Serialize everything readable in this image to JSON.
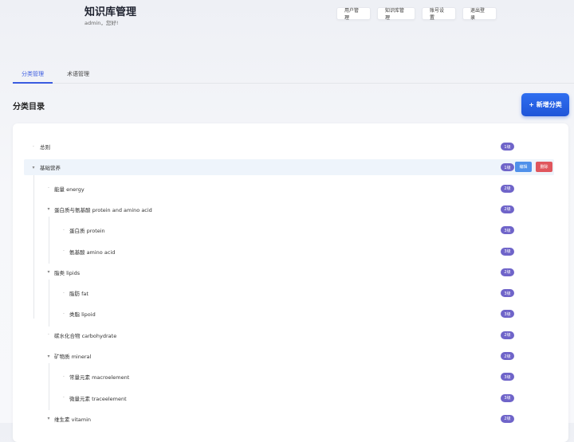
{
  "header": {
    "title": "知识库管理",
    "greeting": "admin，您好!"
  },
  "nav": {
    "user_management": "用户管理",
    "kb_management": "知识库管理",
    "account_settings": "账号设置",
    "logout": "退出登录"
  },
  "tabs": {
    "category": "分类管理",
    "term": "术语管理",
    "active": "category"
  },
  "section": {
    "title": "分类目录",
    "add_button": "+ 新增分类"
  },
  "row_actions": {
    "edit": "编辑",
    "delete": "删除"
  },
  "tree": [
    {
      "label": "总则",
      "level": "1级",
      "toggle": "·",
      "depth": 0
    },
    {
      "label": "基础营养",
      "level": "1级",
      "toggle": "▾",
      "depth": 0,
      "selected": true
    },
    {
      "label": "能量 energy",
      "level": "2级",
      "toggle": "·",
      "depth": 1
    },
    {
      "label": "蛋白质与氨基酸 protein and amino acid",
      "level": "2级",
      "toggle": "▾",
      "depth": 1
    },
    {
      "label": "蛋白质 protein",
      "level": "3级",
      "toggle": "·",
      "depth": 2
    },
    {
      "label": "氨基酸 amino acid",
      "level": "3级",
      "toggle": "·",
      "depth": 2
    },
    {
      "label": "脂类 lipids",
      "level": "2级",
      "toggle": "▾",
      "depth": 1
    },
    {
      "label": "脂肪 fat",
      "level": "3级",
      "toggle": "·",
      "depth": 2
    },
    {
      "label": "类脂 lipoid",
      "level": "3级",
      "toggle": "·",
      "depth": 2
    },
    {
      "label": "碳水化合物 carbohydrate",
      "level": "2级",
      "toggle": "·",
      "depth": 1
    },
    {
      "label": "矿物质 mineral",
      "level": "2级",
      "toggle": "▾",
      "depth": 1
    },
    {
      "label": "常量元素 macroelement",
      "level": "3级",
      "toggle": "·",
      "depth": 2
    },
    {
      "label": "微量元素 traceelement",
      "level": "3级",
      "toggle": "·",
      "depth": 2
    },
    {
      "label": "维生素 vitamin",
      "level": "2级",
      "toggle": "▾",
      "depth": 1
    }
  ]
}
